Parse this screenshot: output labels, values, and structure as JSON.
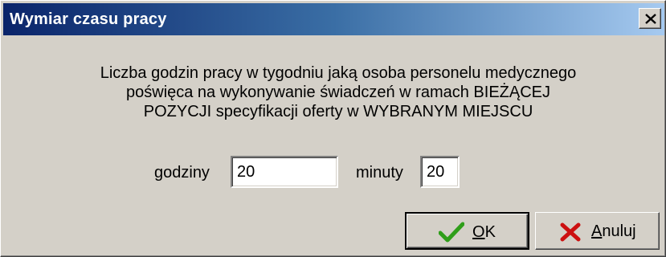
{
  "window": {
    "title": "Wymiar czasu pracy"
  },
  "description": {
    "line1": "Liczba godzin pracy w tygodniu jaką osoba personelu medycznego",
    "line2": "poświęca na wykonywanie świadczeń w ramach BIEŻĄCEJ",
    "line3": "POZYCJI specyfikacji oferty w WYBRANYM MIEJSCU"
  },
  "fields": {
    "hours_label": "godziny",
    "hours_value": "20",
    "minutes_label": "minuty",
    "minutes_value": "20"
  },
  "buttons": {
    "ok_mnemonic": "O",
    "ok_rest": "K",
    "cancel_mnemonic": "A",
    "cancel_rest": "nuluj"
  },
  "icons": {
    "close": "close-icon",
    "ok": "checkmark-icon",
    "cancel": "cross-icon"
  },
  "colors": {
    "title_start": "#0a246a",
    "title_end": "#a6caf0",
    "dialog_bg": "#d4d0c8",
    "check_green": "#2f9e1a",
    "cross_red": "#cc1010"
  }
}
